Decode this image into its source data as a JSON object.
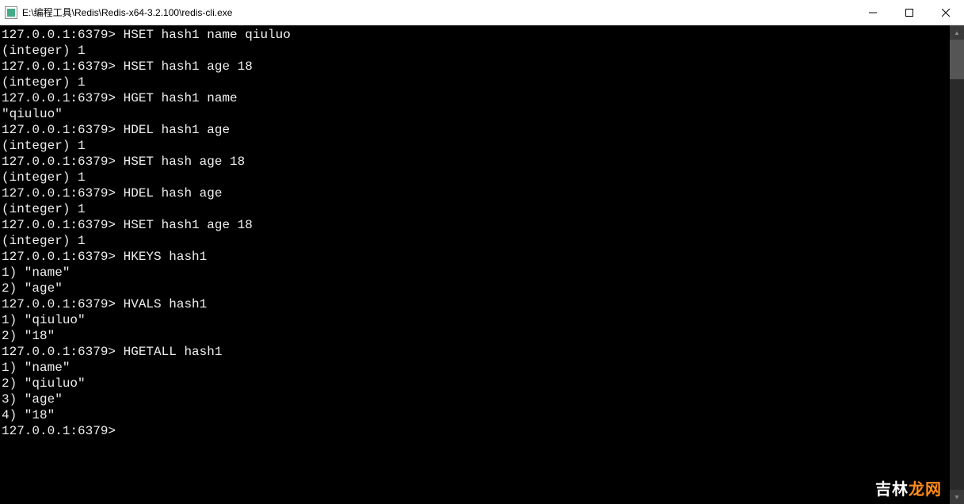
{
  "window": {
    "title": "E:\\编程工具\\Redis\\Redis-x64-3.2.100\\redis-cli.exe"
  },
  "terminal": {
    "prompt": "127.0.0.1:6379>",
    "lines": [
      "127.0.0.1:6379> HSET hash1 name qiuluo",
      "(integer) 1",
      "127.0.0.1:6379> HSET hash1 age 18",
      "(integer) 1",
      "127.0.0.1:6379> HGET hash1 name",
      "\"qiuluo\"",
      "127.0.0.1:6379> HDEL hash1 age",
      "(integer) 1",
      "127.0.0.1:6379> HSET hash age 18",
      "(integer) 1",
      "127.0.0.1:6379> HDEL hash age",
      "(integer) 1",
      "127.0.0.1:6379> HSET hash1 age 18",
      "(integer) 1",
      "127.0.0.1:6379> HKEYS hash1",
      "1) \"name\"",
      "2) \"age\"",
      "127.0.0.1:6379> HVALS hash1",
      "1) \"qiuluo\"",
      "2) \"18\"",
      "127.0.0.1:6379> HGETALL hash1",
      "1) \"name\"",
      "2) \"qiuluo\"",
      "3) \"age\"",
      "4) \"18\"",
      "127.0.0.1:6379>"
    ]
  },
  "watermark": {
    "prefix": "吉林",
    "suffix": "龙网"
  }
}
